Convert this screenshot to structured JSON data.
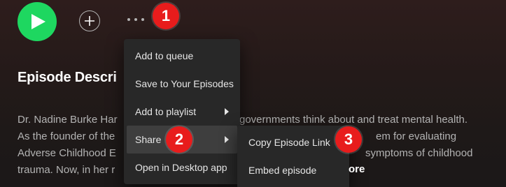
{
  "controls": {
    "play_label": "Play",
    "add_label": "Save",
    "more_label": "More options"
  },
  "annotations": [
    "1",
    "2",
    "3"
  ],
  "heading": "Episode Descri",
  "description": {
    "line1_left": "Dr. Nadine Burke Har",
    "line1_right": "governments think about and treat mental health.",
    "line2_left": "As the founder of the",
    "line2_right": "em for evaluating",
    "line3_left": "Adverse Childhood E",
    "line3_right": "symptoms of childhood",
    "line4_left": "trauma. Now, in her r",
    "more": "ore"
  },
  "context_menu": {
    "items": [
      {
        "label": "Add to queue"
      },
      {
        "label": "Save to Your Episodes"
      },
      {
        "label": "Add to playlist"
      },
      {
        "label": "Share"
      },
      {
        "label": "Open in Desktop app"
      }
    ]
  },
  "share_submenu": {
    "items": [
      {
        "label": "Copy Episode Link"
      },
      {
        "label": "Embed episode"
      }
    ]
  },
  "colors": {
    "accent": "#1ed760",
    "badge": "#e81c1c",
    "menu_bg": "#282828",
    "menu_hover": "#3e3e3e"
  }
}
